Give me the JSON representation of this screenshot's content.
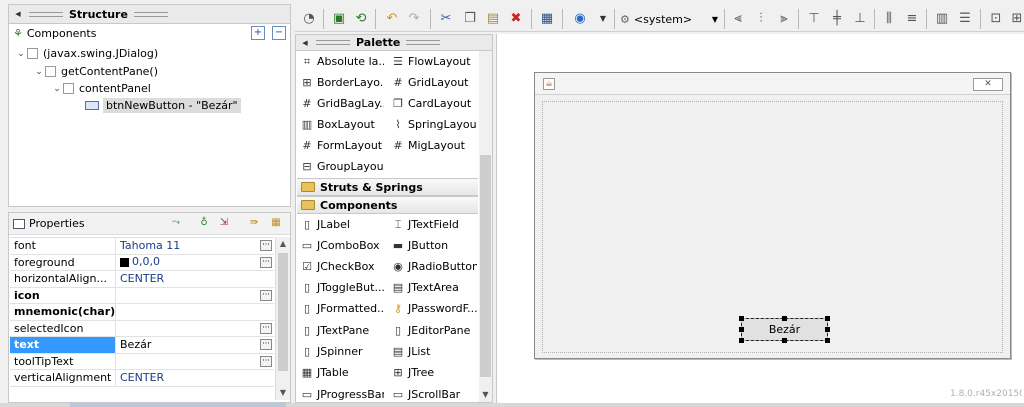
{
  "structure": {
    "title": "Structure",
    "components_label": "Components",
    "tree": [
      {
        "label": "(javax.swing.JDialog)"
      },
      {
        "label": "getContentPane()"
      },
      {
        "label": "contentPanel"
      },
      {
        "label": "btnNewButton - \"Bezár\""
      }
    ]
  },
  "properties": {
    "title": "Properties",
    "rows": [
      {
        "name": "font",
        "value": "Tahoma 11"
      },
      {
        "name": "foreground",
        "value": "0,0,0"
      },
      {
        "name": "horizontalAlign...",
        "value": "CENTER"
      },
      {
        "name": "icon",
        "value": ""
      },
      {
        "name": "mnemonic(char)",
        "value": ""
      },
      {
        "name": "selectedIcon",
        "value": ""
      },
      {
        "name": "text",
        "value": "Bezár"
      },
      {
        "name": "toolTipText",
        "value": ""
      },
      {
        "name": "verticalAlignment",
        "value": "CENTER"
      }
    ]
  },
  "toolbar": {
    "lookandfeel": "<system>"
  },
  "palette": {
    "title": "Palette",
    "layouts": [
      {
        "label": "Absolute la...",
        "icon": "absolute-layout-icon"
      },
      {
        "label": "FlowLayout",
        "icon": "flow-layout-icon"
      },
      {
        "label": "BorderLayo...",
        "icon": "border-layout-icon"
      },
      {
        "label": "GridLayout",
        "icon": "grid-layout-icon"
      },
      {
        "label": "GridBagLay...",
        "icon": "gridbag-layout-icon"
      },
      {
        "label": "CardLayout",
        "icon": "card-layout-icon"
      },
      {
        "label": "BoxLayout",
        "icon": "box-layout-icon"
      },
      {
        "label": "SpringLayout",
        "icon": "spring-layout-icon"
      },
      {
        "label": "FormLayout",
        "icon": "form-layout-icon"
      },
      {
        "label": "MigLayout",
        "icon": "mig-layout-icon"
      },
      {
        "label": "GroupLayout",
        "icon": "group-layout-icon"
      }
    ],
    "categories": {
      "struts": "Struts & Springs",
      "components": "Components"
    },
    "components": [
      {
        "label": "JLabel",
        "icon": "jlabel-icon"
      },
      {
        "label": "JTextField",
        "icon": "jtextfield-icon"
      },
      {
        "label": "JComboBox",
        "icon": "jcombobox-icon"
      },
      {
        "label": "JButton",
        "icon": "jbutton-icon"
      },
      {
        "label": "JCheckBox",
        "icon": "jcheckbox-icon"
      },
      {
        "label": "JRadioButton",
        "icon": "jradiobutton-icon"
      },
      {
        "label": "JToggleBut...",
        "icon": "jtogglebutton-icon"
      },
      {
        "label": "JTextArea",
        "icon": "jtextarea-icon"
      },
      {
        "label": "JFormatted...",
        "icon": "jformattedtextfield-icon"
      },
      {
        "label": "JPasswordF...",
        "icon": "jpasswordfield-icon"
      },
      {
        "label": "JTextPane",
        "icon": "jtextpane-icon"
      },
      {
        "label": "JEditorPane",
        "icon": "jeditorpane-icon"
      },
      {
        "label": "JSpinner",
        "icon": "jspinner-icon"
      },
      {
        "label": "JList",
        "icon": "jlist-icon"
      },
      {
        "label": "JTable",
        "icon": "jtable-icon"
      },
      {
        "label": "JTree",
        "icon": "jtree-icon"
      },
      {
        "label": "JProgressBar",
        "icon": "jprogressbar-icon"
      },
      {
        "label": "JScrollBar",
        "icon": "jscrollbar-icon"
      }
    ]
  },
  "canvas": {
    "button_label": "Bezár",
    "version": "1.8.0.r45x20150"
  }
}
